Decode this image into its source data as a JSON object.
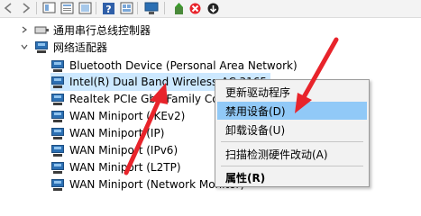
{
  "toolbar": {
    "icons": [
      "back-icon",
      "forward-icon",
      "show-hide-icon",
      "properties-icon",
      "help-icon",
      "resources-icon",
      "monitor-icon",
      "update-driver-icon",
      "disable-device-icon",
      "uninstall-icon",
      "scan-hardware-icon"
    ]
  },
  "tree": {
    "usb_category": "通用串行总线控制器",
    "net_category": "网络适配器",
    "devices": [
      "Bluetooth Device (Personal Area Network)",
      "Intel(R) Dual Band Wireless-AC 3165",
      "Realtek PCIe GbE Family Controller",
      "WAN Miniport (IKEv2)",
      "WAN Miniport (IP)",
      "WAN Miniport (IPv6)",
      "WAN Miniport (L2TP)",
      "WAN Miniport (Network Monitor)"
    ]
  },
  "context_menu": {
    "update_driver": "更新驱动程序",
    "disable_device": "禁用设备(D)",
    "uninstall_device": "卸载设备(U)",
    "scan_hardware": "扫描检测硬件改动(A)",
    "properties": "属性(R)"
  },
  "colors": {
    "selection": "#cce8ff",
    "menu_highlight": "#91c9f7",
    "annotation_arrow": "#e8242b"
  }
}
